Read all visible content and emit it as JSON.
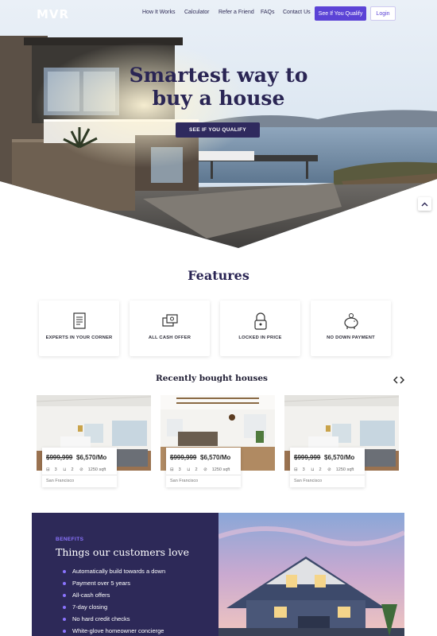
{
  "brand": {
    "logo_text": "MVR"
  },
  "nav": {
    "items": [
      "How It Works",
      "Calculator",
      "Refer a Friend",
      "FAQs",
      "Contact Us"
    ],
    "qualify_button": "See If You Qualify",
    "login_button": "Login"
  },
  "hero": {
    "title_line1": "Smartest way to",
    "title_line2": "buy a house",
    "cta": "SEE IF YOU QUALIFY"
  },
  "features": {
    "title": "Features",
    "items": [
      {
        "label": "EXPERTS IN YOUR CORNER",
        "icon": "document-icon"
      },
      {
        "label": "ALL CASH OFFER",
        "icon": "cash-icon"
      },
      {
        "label": "LOCKED IN PRICE",
        "icon": "lock-icon"
      },
      {
        "label": "NO DOWN PAYMENT",
        "icon": "piggy-bank-icon"
      }
    ]
  },
  "recent": {
    "title": "Recently bought houses",
    "houses": [
      {
        "old_price": "$999,999",
        "new_price": "$6,570/Mo",
        "beds": "3",
        "baths": "2",
        "sqft": "1250 sqft",
        "city": "San Francisco"
      },
      {
        "old_price": "$999,999",
        "new_price": "$6,570/Mo",
        "beds": "3",
        "baths": "2",
        "sqft": "1250 sqft",
        "city": "San Francisco"
      },
      {
        "old_price": "$999,999",
        "new_price": "$6,570/Mo",
        "beds": "3",
        "baths": "2",
        "sqft": "1250 sqft",
        "city": "San Francisco"
      }
    ]
  },
  "benefits": {
    "tag": "BENEFITS",
    "title": "Things our customers love",
    "items": [
      "Automatically build towards a down",
      "Payment over 5 years",
      "All-cash offers",
      "7-day closing",
      "No hard credit checks",
      "White-glove homeowner concierge"
    ]
  },
  "colors": {
    "primary": "#5b43d6",
    "navy": "#2d2958",
    "accent": "#8b74ff"
  }
}
